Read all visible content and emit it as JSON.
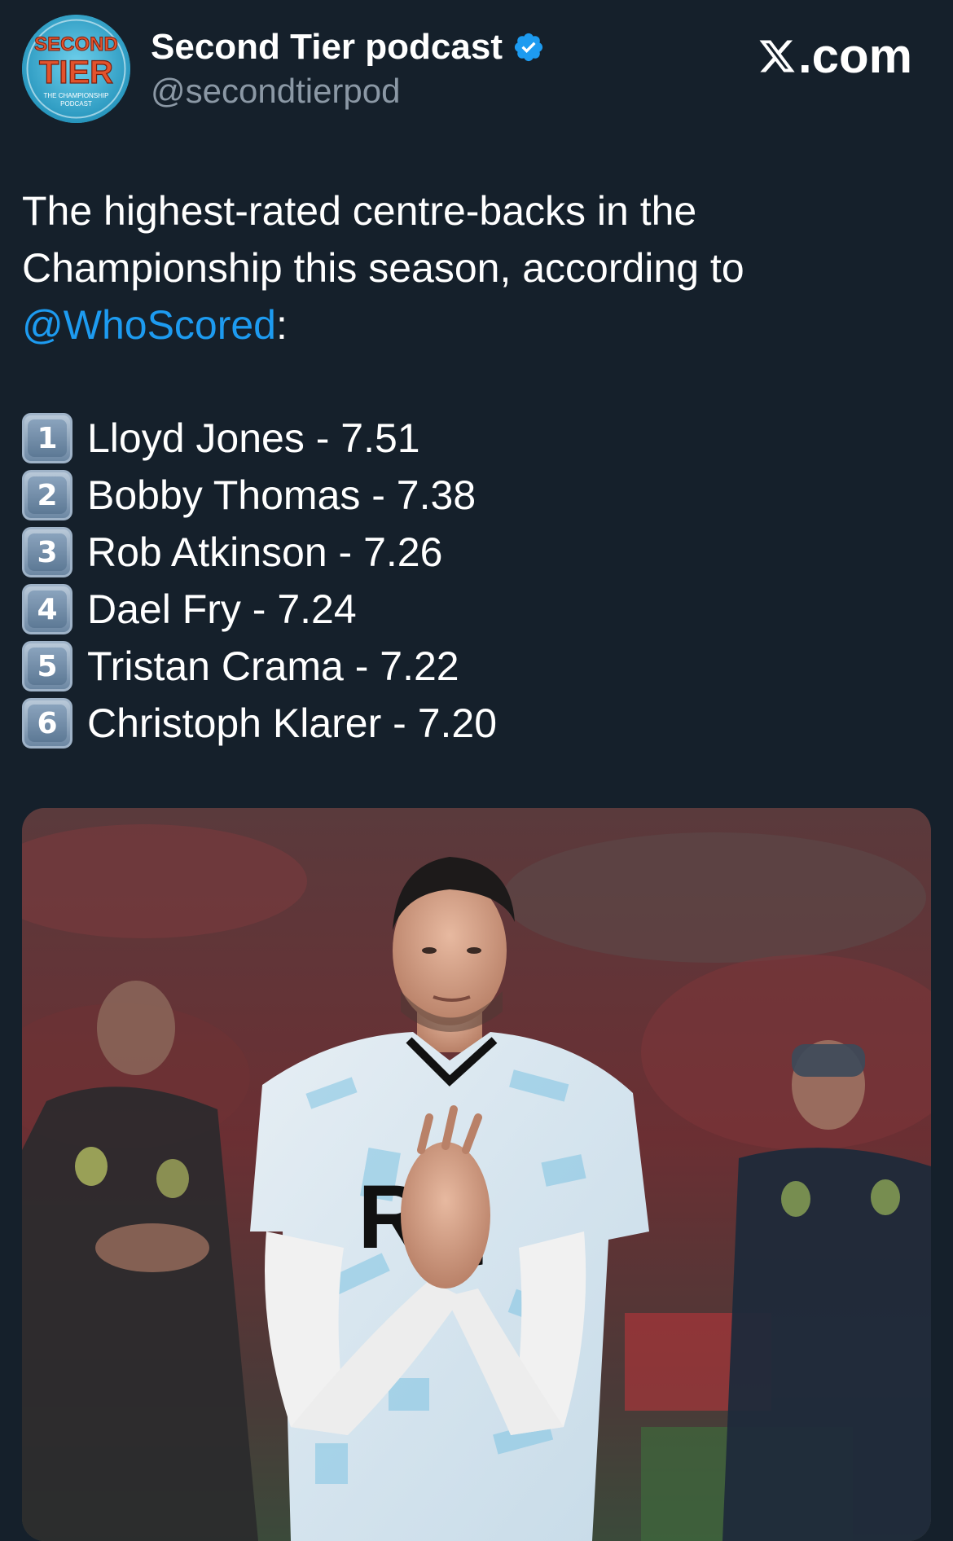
{
  "header": {
    "display_name": "Second Tier podcast",
    "handle": "@secondtierpod",
    "avatar_text_line1": "SECOND",
    "avatar_text_line2": "TIER",
    "avatar_text_line3": "THE CHAMPIONSHIP",
    "avatar_text_line4": "PODCAST",
    "site_suffix": ".com",
    "verified_icon": "verified-badge-icon",
    "brand_icon": "x-logo-icon"
  },
  "tweet": {
    "text_before": "The highest-rated centre-backs in the Championship this season, according to",
    "mention": "@WhoScored",
    "text_after": ":",
    "rankings": [
      {
        "number": "1",
        "text": "Lloyd Jones - 7.51"
      },
      {
        "number": "2",
        "text": "Bobby Thomas - 7.38"
      },
      {
        "number": "3",
        "text": "Rob Atkinson - 7.26"
      },
      {
        "number": "4",
        "text": "Dael Fry - 7.24"
      },
      {
        "number": "5",
        "text": "Tristan Crama - 7.22"
      },
      {
        "number": "6",
        "text": "Christoph Klarer - 7.20"
      }
    ]
  },
  "media": {
    "shirt_sponsor": "RQ"
  },
  "colors": {
    "background": "#15202b",
    "accent": "#1d9bf0",
    "secondary_text": "#8b98a5"
  }
}
